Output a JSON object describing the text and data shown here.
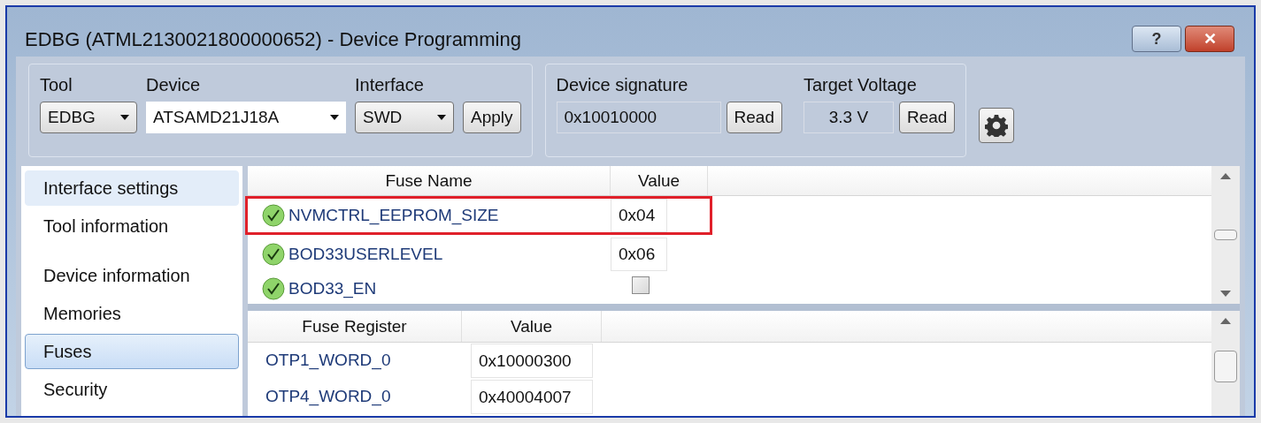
{
  "window": {
    "title": "EDBG (ATML2130021800000652) - Device Programming",
    "buttons": [
      {
        "kind": "help",
        "label": "?"
      },
      {
        "kind": "close",
        "label": "✕"
      }
    ]
  },
  "toolbar": {
    "tool": {
      "label": "Tool",
      "value": "EDBG"
    },
    "device": {
      "label": "Device",
      "value": "ATSAMD21J18A"
    },
    "interface": {
      "label": "Interface",
      "value": "SWD"
    },
    "apply": "Apply",
    "signature": {
      "label": "Device signature",
      "value": "0x10010000",
      "button": "Read"
    },
    "voltage": {
      "label": "Target Voltage",
      "value": "3.3 V",
      "button": "Read"
    }
  },
  "sidebar": {
    "groups": [
      {
        "items": [
          {
            "label": "Interface settings",
            "selected": false,
            "hovered": true
          },
          {
            "label": "Tool information",
            "selected": false,
            "hovered": false
          }
        ]
      },
      {
        "items": [
          {
            "label": "Device information",
            "selected": false,
            "hovered": false
          },
          {
            "label": "Memories",
            "selected": false,
            "hovered": false
          },
          {
            "label": "Fuses",
            "selected": true,
            "hovered": false
          },
          {
            "label": "Security",
            "selected": false,
            "hovered": false
          }
        ]
      }
    ]
  },
  "fuses": {
    "columns": [
      "Fuse Name",
      "Value"
    ],
    "rows": [
      {
        "name": "NVMCTRL_EEPROM_SIZE",
        "kind": "text",
        "value": "0x04",
        "highlighted": true
      },
      {
        "name": "BOD33USERLEVEL",
        "kind": "text",
        "value": "0x06",
        "highlighted": false
      },
      {
        "name": "BOD33_EN",
        "kind": "checkbox",
        "checked": false,
        "highlighted": false
      }
    ]
  },
  "registers": {
    "columns": [
      "Fuse Register",
      "Value"
    ],
    "rows": [
      {
        "name": "OTP1_WORD_0",
        "value": "0x10000300"
      },
      {
        "name": "OTP4_WORD_0",
        "value": "0x40004007"
      }
    ]
  }
}
